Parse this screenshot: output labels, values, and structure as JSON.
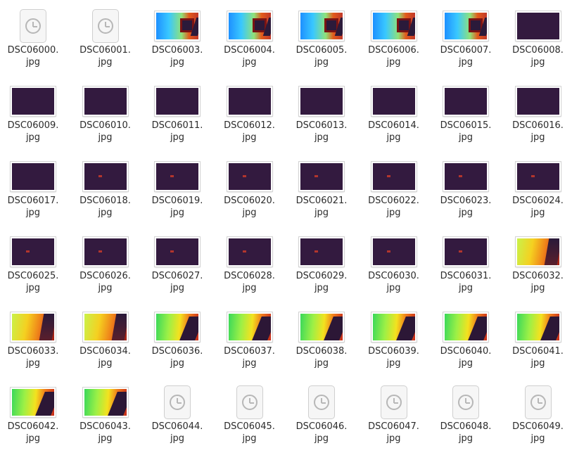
{
  "files": [
    {
      "name": "DSC06000.",
      "ext": "jpg",
      "thumb": "placeholder"
    },
    {
      "name": "DSC06001.",
      "ext": "jpg",
      "thumb": "placeholder"
    },
    {
      "name": "DSC06003.",
      "ext": "jpg",
      "thumb": "blue"
    },
    {
      "name": "DSC06004.",
      "ext": "jpg",
      "thumb": "blue"
    },
    {
      "name": "DSC06005.",
      "ext": "jpg",
      "thumb": "blue"
    },
    {
      "name": "DSC06006.",
      "ext": "jpg",
      "thumb": "blue"
    },
    {
      "name": "DSC06007.",
      "ext": "jpg",
      "thumb": "blue"
    },
    {
      "name": "DSC06008.",
      "ext": "jpg",
      "thumb": "dark"
    },
    {
      "name": "DSC06009.",
      "ext": "jpg",
      "thumb": "dark"
    },
    {
      "name": "DSC06010.",
      "ext": "jpg",
      "thumb": "dark"
    },
    {
      "name": "DSC06011.",
      "ext": "jpg",
      "thumb": "dark"
    },
    {
      "name": "DSC06012.",
      "ext": "jpg",
      "thumb": "dark"
    },
    {
      "name": "DSC06013.",
      "ext": "jpg",
      "thumb": "dark"
    },
    {
      "name": "DSC06014.",
      "ext": "jpg",
      "thumb": "dark"
    },
    {
      "name": "DSC06015.",
      "ext": "jpg",
      "thumb": "dark"
    },
    {
      "name": "DSC06016.",
      "ext": "jpg",
      "thumb": "dark"
    },
    {
      "name": "DSC06017.",
      "ext": "jpg",
      "thumb": "dark"
    },
    {
      "name": "DSC06018.",
      "ext": "jpg",
      "thumb": "dark-dot"
    },
    {
      "name": "DSC06019.",
      "ext": "jpg",
      "thumb": "dark-dot"
    },
    {
      "name": "DSC06020.",
      "ext": "jpg",
      "thumb": "dark-dot"
    },
    {
      "name": "DSC06021.",
      "ext": "jpg",
      "thumb": "dark-dot"
    },
    {
      "name": "DSC06022.",
      "ext": "jpg",
      "thumb": "dark-dot"
    },
    {
      "name": "DSC06023.",
      "ext": "jpg",
      "thumb": "dark-dot"
    },
    {
      "name": "DSC06024.",
      "ext": "jpg",
      "thumb": "dark-dot"
    },
    {
      "name": "DSC06025.",
      "ext": "jpg",
      "thumb": "dark-dot"
    },
    {
      "name": "DSC06026.",
      "ext": "jpg",
      "thumb": "dark-dot"
    },
    {
      "name": "DSC06027.",
      "ext": "jpg",
      "thumb": "dark-dot"
    },
    {
      "name": "DSC06028.",
      "ext": "jpg",
      "thumb": "dark-dot"
    },
    {
      "name": "DSC06029.",
      "ext": "jpg",
      "thumb": "dark-dot"
    },
    {
      "name": "DSC06030.",
      "ext": "jpg",
      "thumb": "dark-dot"
    },
    {
      "name": "DSC06031.",
      "ext": "jpg",
      "thumb": "dark-dot"
    },
    {
      "name": "DSC06032.",
      "ext": "jpg",
      "thumb": "warm"
    },
    {
      "name": "DSC06033.",
      "ext": "jpg",
      "thumb": "warm"
    },
    {
      "name": "DSC06034.",
      "ext": "jpg",
      "thumb": "warm"
    },
    {
      "name": "DSC06036.",
      "ext": "jpg",
      "thumb": "green"
    },
    {
      "name": "DSC06037.",
      "ext": "jpg",
      "thumb": "green"
    },
    {
      "name": "DSC06038.",
      "ext": "jpg",
      "thumb": "green"
    },
    {
      "name": "DSC06039.",
      "ext": "jpg",
      "thumb": "green"
    },
    {
      "name": "DSC06040.",
      "ext": "jpg",
      "thumb": "green"
    },
    {
      "name": "DSC06041.",
      "ext": "jpg",
      "thumb": "green"
    },
    {
      "name": "DSC06042.",
      "ext": "jpg",
      "thumb": "green"
    },
    {
      "name": "DSC06043.",
      "ext": "jpg",
      "thumb": "green"
    },
    {
      "name": "DSC06044.",
      "ext": "jpg",
      "thumb": "placeholder"
    },
    {
      "name": "DSC06045.",
      "ext": "jpg",
      "thumb": "placeholder"
    },
    {
      "name": "DSC06046.",
      "ext": "jpg",
      "thumb": "placeholder"
    },
    {
      "name": "DSC06047.",
      "ext": "jpg",
      "thumb": "placeholder"
    },
    {
      "name": "DSC06048.",
      "ext": "jpg",
      "thumb": "placeholder"
    },
    {
      "name": "DSC06049.",
      "ext": "jpg",
      "thumb": "placeholder"
    }
  ],
  "icons": {
    "placeholder": "clock-icon",
    "thumbnail": "image-thumbnail"
  },
  "colors": {
    "background": "#ffffff",
    "text": "#2b2b2b",
    "dark_thumb": "#331a3f"
  }
}
